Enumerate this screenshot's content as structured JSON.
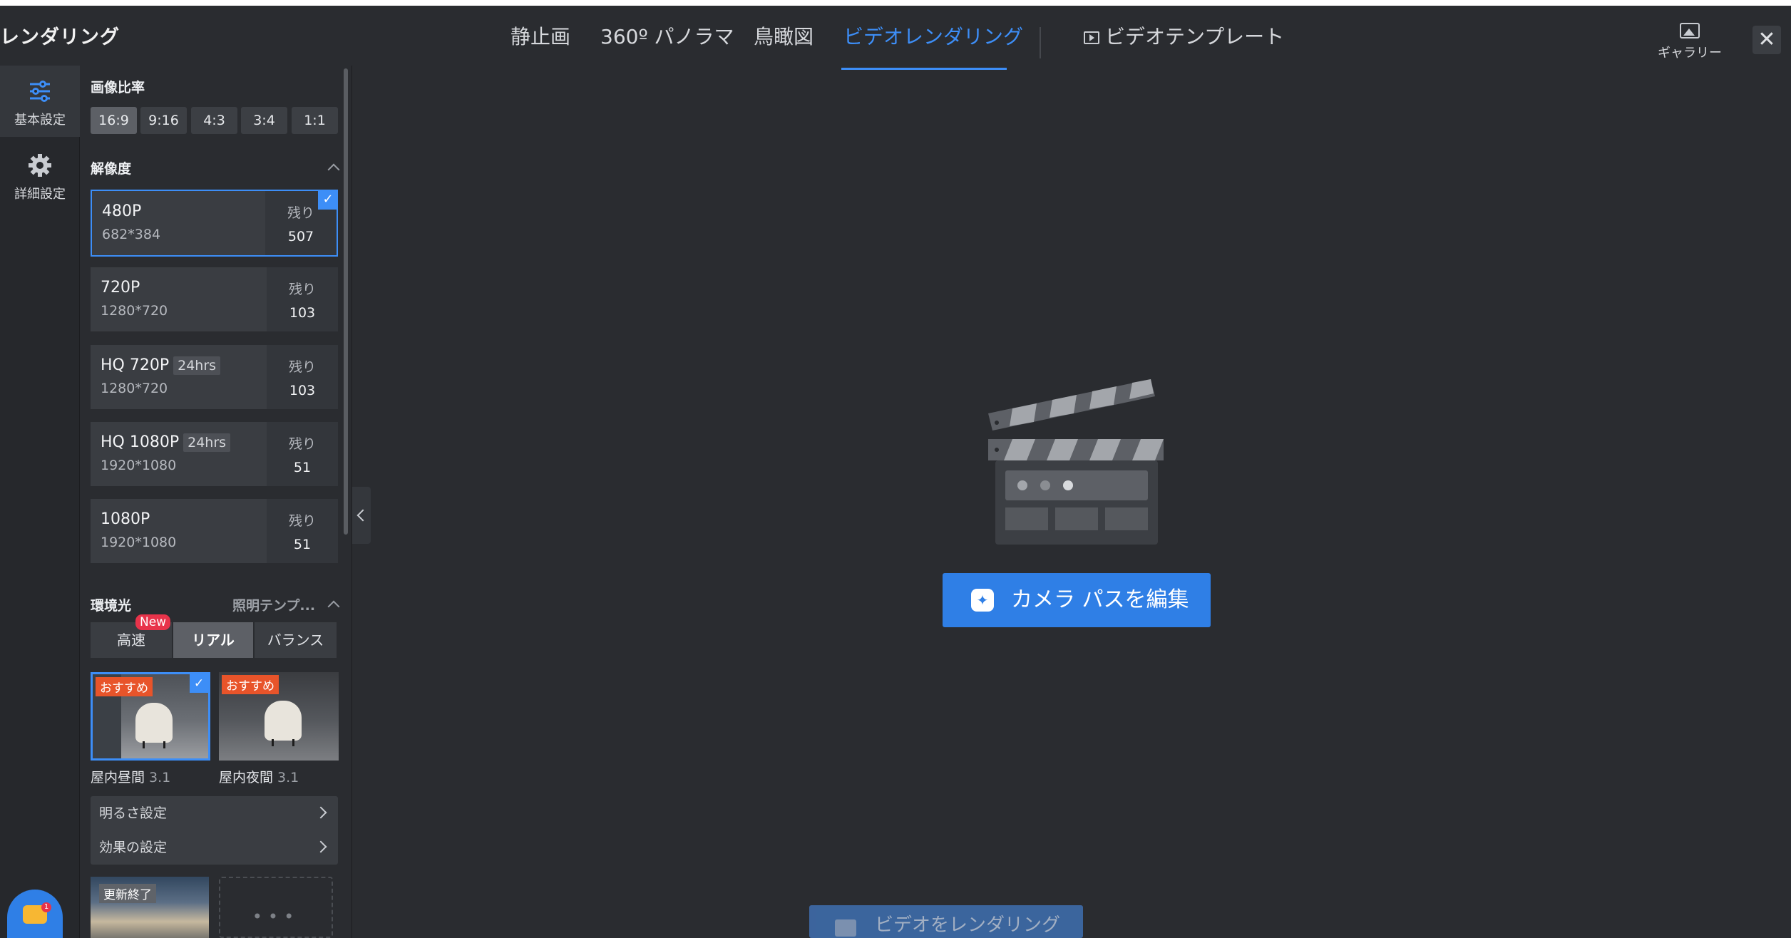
{
  "app": {
    "title": "レンダリング"
  },
  "tabs": [
    {
      "label": "静止画"
    },
    {
      "label": "360º パノラマ"
    },
    {
      "label": "鳥瞰図"
    },
    {
      "label": "ビデオレンダリング",
      "active": true
    }
  ],
  "video_template": {
    "label": "ビデオテンプレート"
  },
  "gallery": {
    "label": "ギャラリー"
  },
  "leftnav": {
    "items": [
      {
        "label": "基本設定",
        "icon": "sliders-icon",
        "active": true
      },
      {
        "label": "詳細設定",
        "icon": "gear-icon"
      }
    ]
  },
  "aspect_ratio": {
    "title": "画像比率",
    "options": [
      "16:9",
      "9:16",
      "4:3",
      "3:4",
      "1:1"
    ],
    "selected": "16:9"
  },
  "resolution": {
    "title": "解像度",
    "remaining_label": "残り",
    "items": [
      {
        "name": "480P",
        "dims": "682*384",
        "badge": "",
        "remaining": "507",
        "selected": true
      },
      {
        "name": "720P",
        "dims": "1280*720",
        "badge": "",
        "remaining": "103"
      },
      {
        "name": "HQ 720P",
        "dims": "1280*720",
        "badge": "24hrs",
        "remaining": "103"
      },
      {
        "name": "HQ 1080P",
        "dims": "1920*1080",
        "badge": "24hrs",
        "remaining": "51"
      },
      {
        "name": "1080P",
        "dims": "1920*1080",
        "badge": "",
        "remaining": "51"
      }
    ]
  },
  "lighting": {
    "title": "環境光",
    "template_link": "照明テンプ...",
    "modes": [
      "高速",
      "リアル",
      "バランス"
    ],
    "selected_mode": "リアル",
    "new_badge": "New",
    "presets": [
      {
        "tag": "おすすめ",
        "name": "屋内昼間",
        "version": "3.1",
        "selected": true
      },
      {
        "tag": "おすすめ",
        "name": "屋内夜間",
        "version": "3.1"
      }
    ],
    "settings": [
      "明るさ設定",
      "効果の設定"
    ],
    "update_tag": "更新終了"
  },
  "main": {
    "edit_camera_label": "カメラ パスを編集",
    "render_video_label": "ビデオをレンダリング"
  },
  "chat": {
    "badge": "1"
  },
  "colors": {
    "accent": "#3d8ef7",
    "background": "#2a2c30",
    "panel": "#3a3d42"
  }
}
